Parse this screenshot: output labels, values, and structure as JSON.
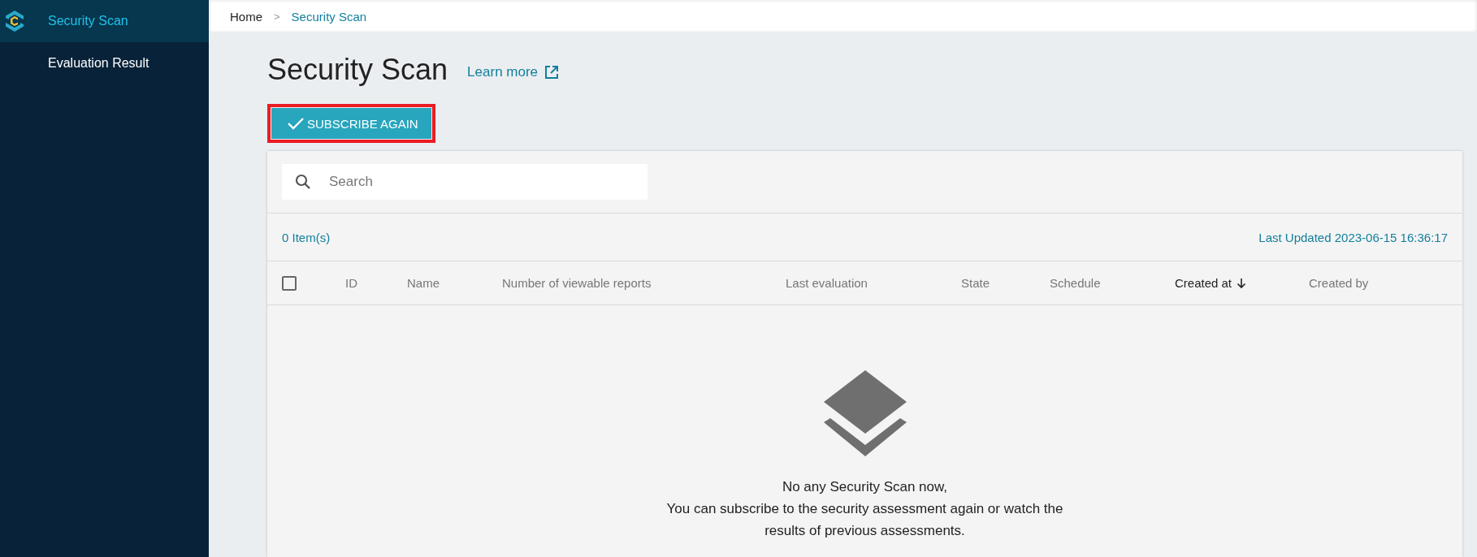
{
  "sidebar": {
    "items": [
      {
        "label": "Security Scan",
        "selected": true
      },
      {
        "label": "Evaluation Result",
        "selected": false
      }
    ]
  },
  "breadcrumb": [
    {
      "label": "Home",
      "current": false
    },
    {
      "label": "Security Scan",
      "current": true
    }
  ],
  "breadcrumb_separator": ">",
  "page": {
    "title": "Security Scan",
    "learn_more": "Learn more"
  },
  "subscribe_button": {
    "label": "SUBSCRIBE AGAIN",
    "highlighted": true
  },
  "search": {
    "placeholder": "Search"
  },
  "table": {
    "item_count": "0 Item(s)",
    "last_updated": "Last Updated 2023-06-15 16:36:17",
    "select_all_checked": false,
    "columns": [
      {
        "label": "ID",
        "sorted": false
      },
      {
        "label": "Name",
        "sorted": false
      },
      {
        "label": "Number of viewable reports",
        "sorted": false
      },
      {
        "label": "Last evaluation",
        "sorted": false
      },
      {
        "label": "State",
        "sorted": false
      },
      {
        "label": "Schedule",
        "sorted": false
      },
      {
        "label": "Created at",
        "sorted": true
      },
      {
        "label": "Created by",
        "sorted": false
      }
    ],
    "empty_message": [
      "No any Security Scan now,",
      "You can subscribe to the security assessment again or watch the results of previous assessments."
    ]
  }
}
